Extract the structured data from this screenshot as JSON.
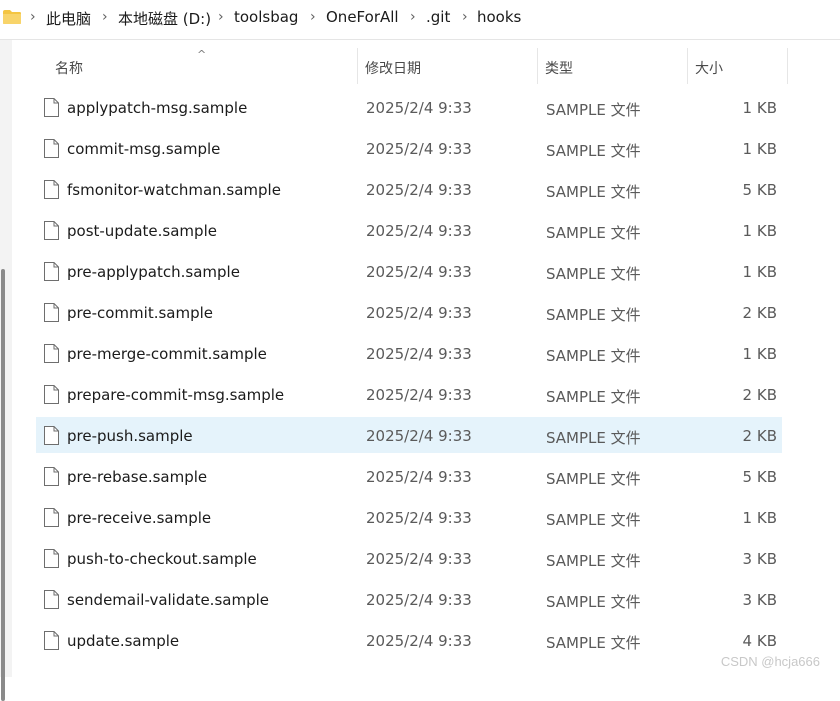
{
  "breadcrumb": {
    "items": [
      "此电脑",
      "本地磁盘 (D:)",
      "toolsbag",
      "OneForAll",
      ".git",
      "hooks"
    ]
  },
  "columns": {
    "name": "名称",
    "date": "修改日期",
    "type": "类型",
    "size": "大小"
  },
  "files": [
    {
      "name": "applypatch-msg.sample",
      "date": "2025/2/4 9:33",
      "type": "SAMPLE 文件",
      "size": "1 KB"
    },
    {
      "name": "commit-msg.sample",
      "date": "2025/2/4 9:33",
      "type": "SAMPLE 文件",
      "size": "1 KB"
    },
    {
      "name": "fsmonitor-watchman.sample",
      "date": "2025/2/4 9:33",
      "type": "SAMPLE 文件",
      "size": "5 KB"
    },
    {
      "name": "post-update.sample",
      "date": "2025/2/4 9:33",
      "type": "SAMPLE 文件",
      "size": "1 KB"
    },
    {
      "name": "pre-applypatch.sample",
      "date": "2025/2/4 9:33",
      "type": "SAMPLE 文件",
      "size": "1 KB"
    },
    {
      "name": "pre-commit.sample",
      "date": "2025/2/4 9:33",
      "type": "SAMPLE 文件",
      "size": "2 KB"
    },
    {
      "name": "pre-merge-commit.sample",
      "date": "2025/2/4 9:33",
      "type": "SAMPLE 文件",
      "size": "1 KB"
    },
    {
      "name": "prepare-commit-msg.sample",
      "date": "2025/2/4 9:33",
      "type": "SAMPLE 文件",
      "size": "2 KB"
    },
    {
      "name": "pre-push.sample",
      "date": "2025/2/4 9:33",
      "type": "SAMPLE 文件",
      "size": "2 KB",
      "selected": true
    },
    {
      "name": "pre-rebase.sample",
      "date": "2025/2/4 9:33",
      "type": "SAMPLE 文件",
      "size": "5 KB"
    },
    {
      "name": "pre-receive.sample",
      "date": "2025/2/4 9:33",
      "type": "SAMPLE 文件",
      "size": "1 KB"
    },
    {
      "name": "push-to-checkout.sample",
      "date": "2025/2/4 9:33",
      "type": "SAMPLE 文件",
      "size": "3 KB"
    },
    {
      "name": "sendemail-validate.sample",
      "date": "2025/2/4 9:33",
      "type": "SAMPLE 文件",
      "size": "3 KB"
    },
    {
      "name": "update.sample",
      "date": "2025/2/4 9:33",
      "type": "SAMPLE 文件",
      "size": "4 KB"
    }
  ],
  "icons": {
    "folder": "folder-icon",
    "file": "file-icon",
    "chevron": "chevron-right-icon",
    "sort": "sort-up-icon"
  },
  "colors": {
    "selected_row": "#e5f3fb",
    "folder": "#f4c542"
  },
  "watermark": "CSDN @hcja666"
}
